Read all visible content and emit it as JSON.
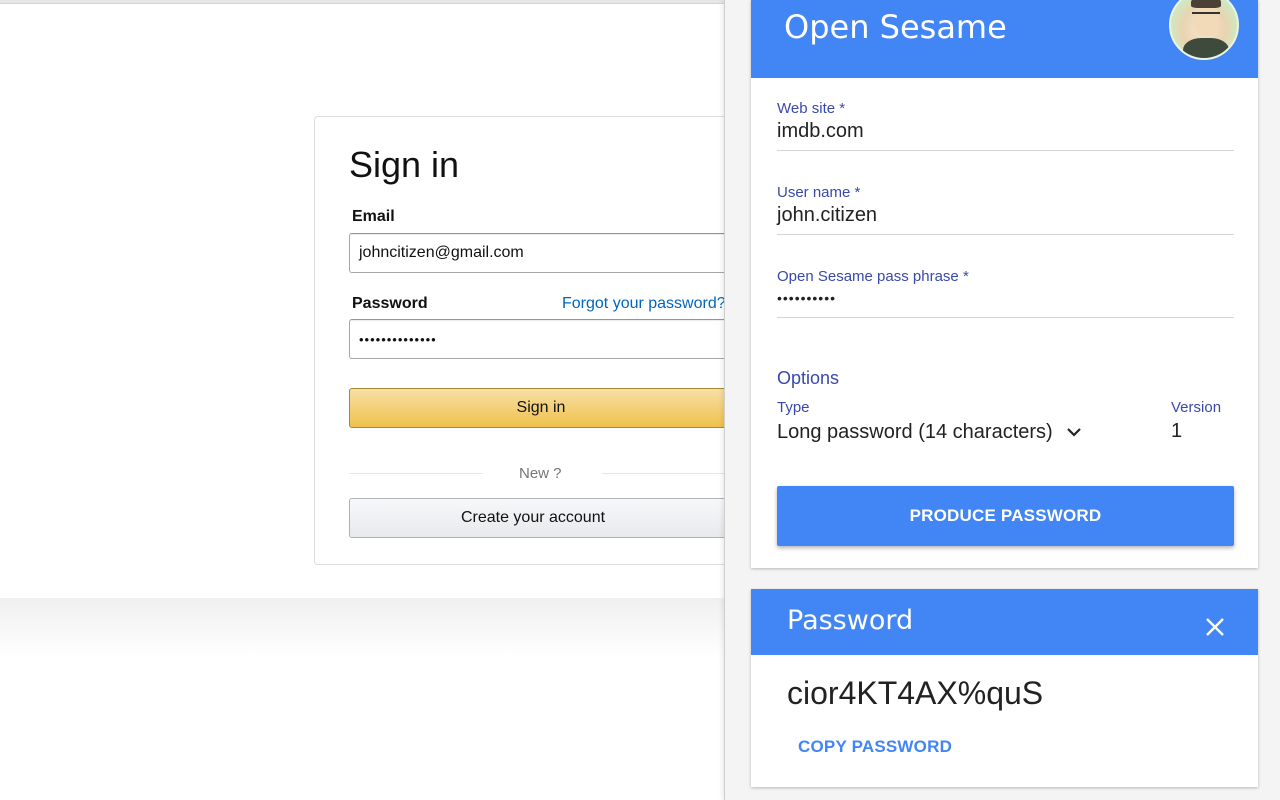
{
  "signin": {
    "title": "Sign in",
    "email_label": "Email",
    "email_value": "johncitizen@gmail.com",
    "password_label": "Password",
    "forgot_link": "Forgot your password?",
    "password_value": "••••••••••••••",
    "signin_button": "Sign in",
    "new_text": "New ?",
    "create_account_button": "Create your account"
  },
  "open_sesame": {
    "title": "Open Sesame",
    "avatar": "user-avatar",
    "website_label": "Web site *",
    "website_value": "imdb.com",
    "username_label": "User name *",
    "username_value": "john.citizen",
    "passphrase_label": "Open Sesame pass phrase *",
    "passphrase_value": "••••••••••",
    "options_heading": "Options",
    "type_label": "Type",
    "type_value": "Long password (14 characters)",
    "version_label": "Version",
    "version_value": "1",
    "produce_button": "PRODUCE PASSWORD"
  },
  "password_card": {
    "title": "Password",
    "value": "cior4KT4AX%quS",
    "copy_button": "COPY PASSWORD"
  },
  "colors": {
    "accent_blue": "#4285f4",
    "label_indigo": "#3949ab",
    "link_blue": "#0066c0",
    "signin_yellow": "#f0c14b"
  },
  "icons": [
    "chevron-down-icon",
    "close-icon"
  ]
}
